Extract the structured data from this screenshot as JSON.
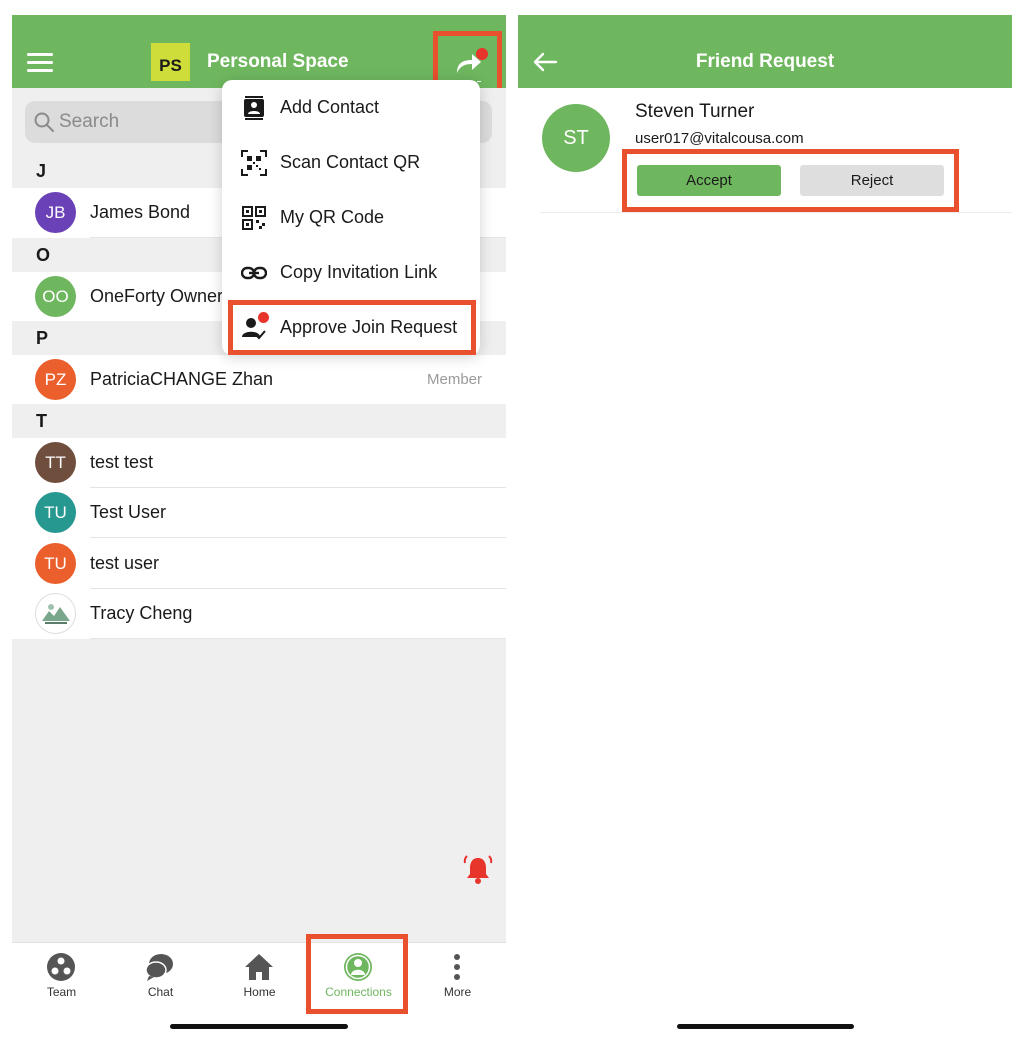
{
  "colors": {
    "brand_green": "#6fb75f",
    "highlight": "#e8502e",
    "notification_red": "#e8352b"
  },
  "left": {
    "header": {
      "logo_text": "PS",
      "title": "Personal Space"
    },
    "search": {
      "placeholder": "Search"
    },
    "sections": [
      "J",
      "O",
      "P",
      "T"
    ],
    "contacts": [
      {
        "initials": "JB",
        "name": "James Bond",
        "role": "",
        "color": "#6b41b8"
      },
      {
        "initials": "OO",
        "name": "OneForty Owner",
        "role": "",
        "color": "#6fb75f"
      },
      {
        "initials": "PZ",
        "name": "PatriciaCHANGE Zhan",
        "role": "Member",
        "color": "#ea5f2c"
      },
      {
        "initials": "TT",
        "name": "test test",
        "role": "",
        "color": "#6f4e3e"
      },
      {
        "initials": "TU",
        "name": "Test User",
        "role": "",
        "color": "#279890"
      },
      {
        "initials": "TU",
        "name": "test user",
        "role": "",
        "color": "#ea5f2c"
      },
      {
        "initials": "",
        "name": "Tracy Cheng",
        "role": "",
        "color": "#ffffff"
      }
    ],
    "menu": [
      {
        "label": "Add Contact",
        "icon": "contact-book-icon"
      },
      {
        "label": "Scan Contact QR",
        "icon": "qr-scan-icon"
      },
      {
        "label": "My QR Code",
        "icon": "qr-code-icon"
      },
      {
        "label": "Copy Invitation Link",
        "icon": "link-icon"
      },
      {
        "label": "Approve Join Request",
        "icon": "user-check-icon"
      }
    ],
    "tabs": [
      {
        "label": "Team",
        "icon": "team-icon",
        "active": false
      },
      {
        "label": "Chat",
        "icon": "chat-icon",
        "active": false
      },
      {
        "label": "Home",
        "icon": "home-icon",
        "active": false
      },
      {
        "label": "Connections",
        "icon": "connections-icon",
        "active": true
      },
      {
        "label": "More",
        "icon": "more-icon",
        "active": false
      }
    ]
  },
  "right": {
    "header": {
      "title": "Friend Request"
    },
    "request": {
      "initials": "ST",
      "name": "Steven Turner",
      "email": "user017@vitalcousa.com"
    },
    "buttons": {
      "accept": "Accept",
      "reject": "Reject"
    }
  }
}
